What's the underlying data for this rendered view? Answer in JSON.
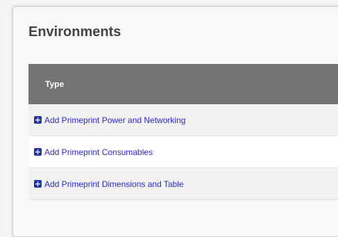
{
  "panel": {
    "title": "Environments"
  },
  "table": {
    "header": "Type",
    "rows": [
      {
        "label": "Add Primeprint Power and Networking",
        "icon": "plus-square-icon"
      },
      {
        "label": "Add Primeprint Consumables",
        "icon": "plus-square-icon"
      },
      {
        "label": "Add Primeprint Dimensions and Table",
        "icon": "plus-square-icon"
      }
    ]
  },
  "colors": {
    "header_bg": "#747474",
    "link": "#2a2ad0",
    "icon": "#2233aa"
  }
}
